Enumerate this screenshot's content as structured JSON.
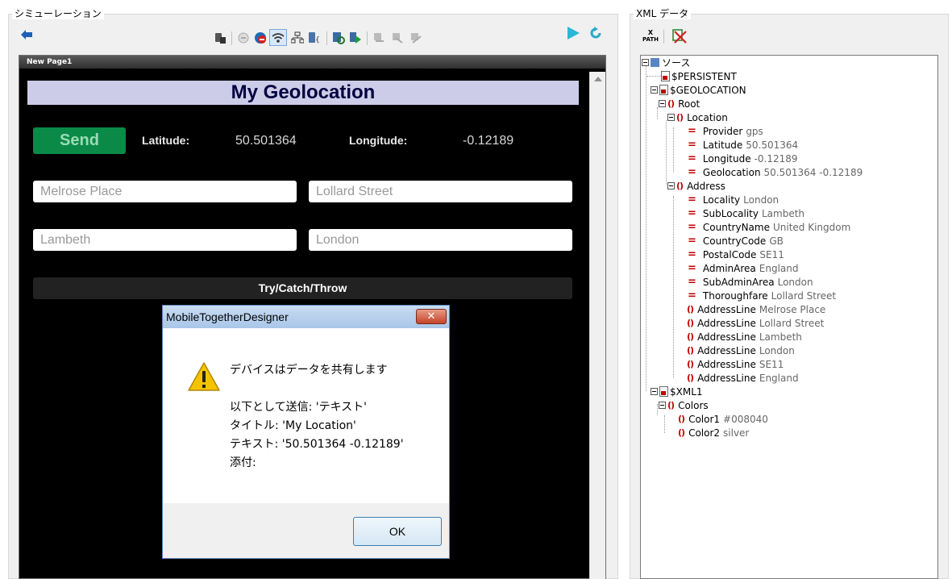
{
  "simulator": {
    "title": "シミューレーション",
    "page_tab": "New Page1",
    "app_title": "My Geolocation",
    "send_label": "Send",
    "latitude_label": "Latitude:",
    "latitude_value": "50.501364",
    "longitude_label": "Longitude:",
    "longitude_value": "-0.12189",
    "inputs": [
      {
        "value": "Melrose Place"
      },
      {
        "value": "Lollard Street"
      },
      {
        "value": "Lambeth"
      },
      {
        "value": "London"
      }
    ],
    "try_catch_label": "Try/Catch/Throw"
  },
  "dialog": {
    "title": "MobileTogetherDesigner",
    "close_label": "✕",
    "heading": "デバイスはデータを共有します",
    "line1": "以下として送信: 'テキスト'",
    "line2": "タイトル: 'My Location'",
    "line3": "テキスト: '50.501364 -0.12189'",
    "line4": "添付:",
    "ok_label": "OK"
  },
  "xml_panel": {
    "title": "XML データ",
    "xpath_label": "PATH",
    "tree": [
      {
        "key": "ソース",
        "value": ""
      },
      {
        "key": "$PERSISTENT",
        "value": ""
      },
      {
        "key": "$GEOLOCATION",
        "value": ""
      },
      {
        "key": "Root",
        "value": ""
      },
      {
        "key": "Location",
        "value": ""
      },
      {
        "key": "Provider",
        "value": "gps"
      },
      {
        "key": "Latitude",
        "value": "50.501364"
      },
      {
        "key": "Longitude",
        "value": "-0.12189"
      },
      {
        "key": "Geolocation",
        "value": "50.501364 -0.12189"
      },
      {
        "key": "Address",
        "value": ""
      },
      {
        "key": "Locality",
        "value": "London"
      },
      {
        "key": "SubLocality",
        "value": "Lambeth"
      },
      {
        "key": "CountryName",
        "value": "United Kingdom"
      },
      {
        "key": "CountryCode",
        "value": "GB"
      },
      {
        "key": "PostalCode",
        "value": "SE11"
      },
      {
        "key": "AdminArea",
        "value": "England"
      },
      {
        "key": "SubAdminArea",
        "value": "London"
      },
      {
        "key": "Thoroughfare",
        "value": "Lollard Street"
      },
      {
        "key": "AddressLine",
        "value": "Melrose Place"
      },
      {
        "key": "AddressLine",
        "value": "Lollard Street"
      },
      {
        "key": "AddressLine",
        "value": "Lambeth"
      },
      {
        "key": "AddressLine",
        "value": "London"
      },
      {
        "key": "AddressLine",
        "value": "SE11"
      },
      {
        "key": "AddressLine",
        "value": "England"
      },
      {
        "key": "$XML1",
        "value": ""
      },
      {
        "key": "Colors",
        "value": ""
      },
      {
        "key": "Color1",
        "value": "#008040"
      },
      {
        "key": "Color2",
        "value": "silver"
      }
    ]
  },
  "colors": {
    "send_button": "#0a8a46",
    "title_bar": "#cccce8",
    "tree_icon_red": "#c00000"
  }
}
